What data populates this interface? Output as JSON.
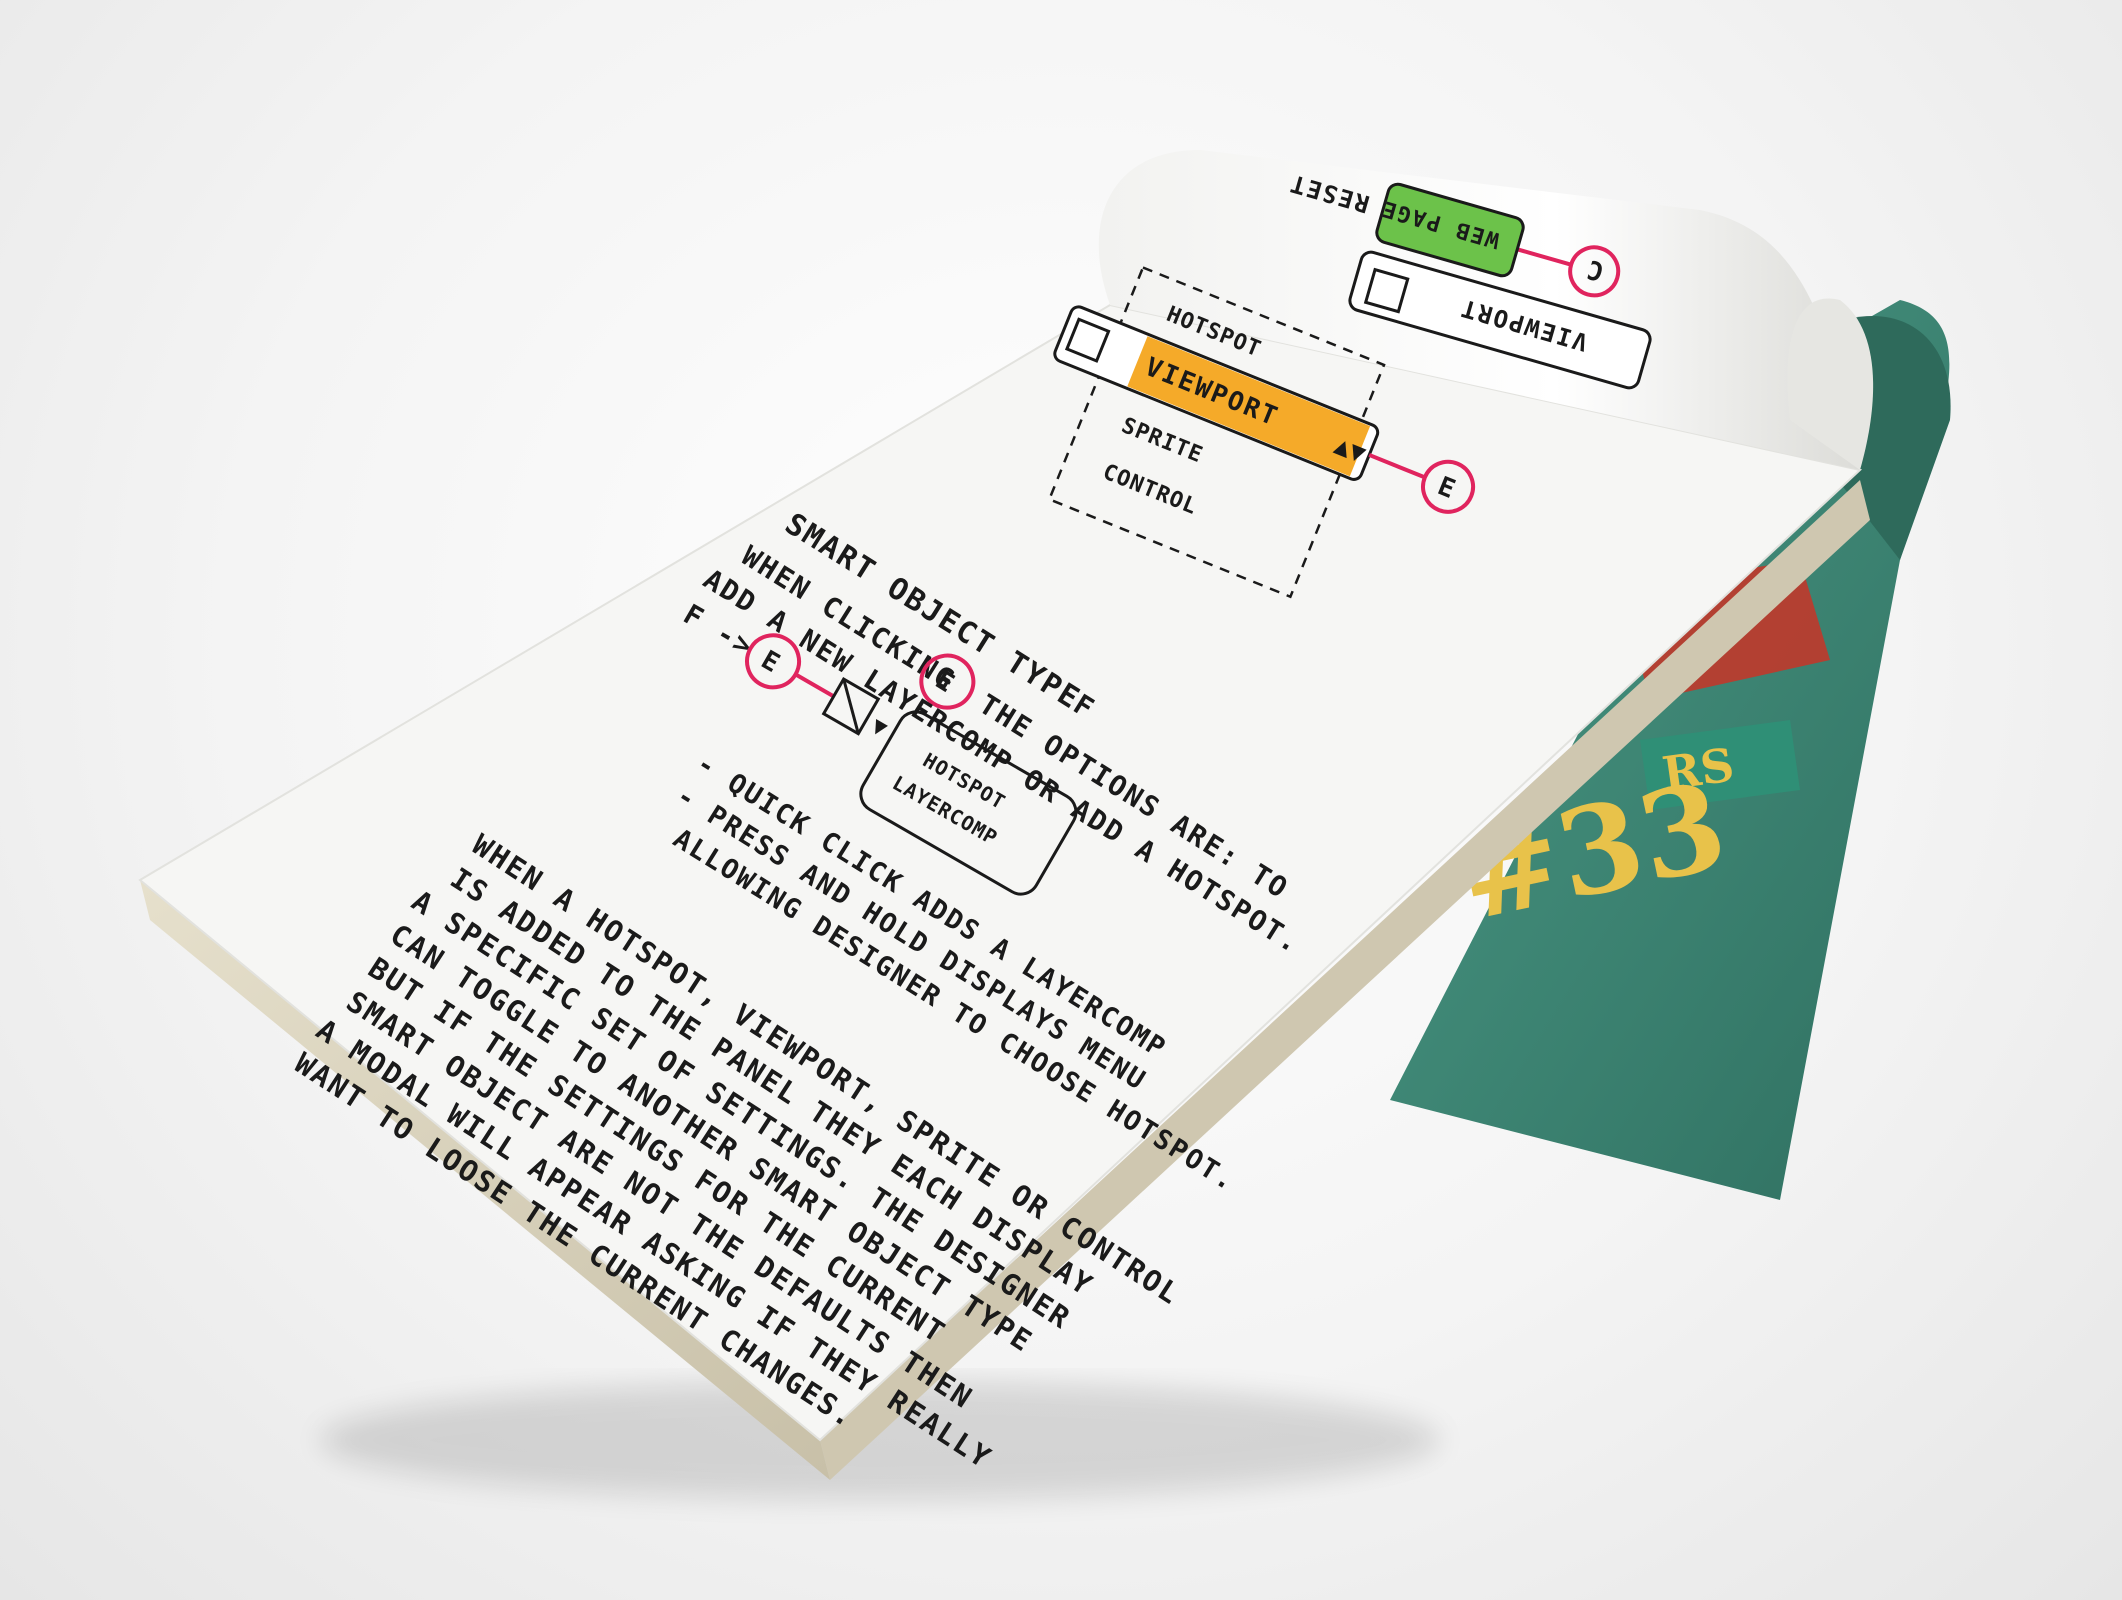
{
  "notepad": {
    "paper_color": "#f6f6f4",
    "edge_color": "#d8d2c0",
    "heading": "SMART OBJECT TYPE",
    "intro_lines": [
      "WHEN CLICKING",
      "THE OPTIONS ARE: TO",
      "ADD A NEW LAYERCOMP OR ADD A HOTSPOT."
    ],
    "marker_e": "E",
    "marker_f": "F",
    "marker_c": "C",
    "f_arrow_label": "F ->",
    "dropdown_options": [
      "HOTSPOT",
      "VIEWPORT",
      "SPRITE",
      "CONTROL"
    ],
    "dropdown_selected": "VIEWPORT",
    "dropdown_highlight_color": "#f4a51e",
    "popup_menu": [
      "HOTSPOT",
      "LAYERCOMP"
    ],
    "bullets": [
      "- QUICK CLICK ADDS A LAYERCOMP",
      "- PRESS AND HOLD DISPLAYS MENU",
      "ALLOWING DESIGNER TO CHOOSE HOTSPOT."
    ],
    "paragraph": [
      "WHEN A HOTSPOT, VIEWPORT, SPRITE OR CONTROL",
      "IS ADDED TO THE PANEL THEY EACH DISPLAY",
      "A SPECIFIC SET OF SETTINGS. THE DESIGNER",
      "CAN TOGGLE TO ANOTHER SMART OBJECT TYPE",
      "BUT IF THE SETTINGS FOR THE CURRENT",
      "SMART OBJECT ARE NOT THE DEFAULTS THEN",
      "A MODAL WILL APPEAR ASKING IF THEY REALLY",
      "WANT TO LOOSE THE CURRENT CHANGES."
    ],
    "curled_page": {
      "reset_label": "RESET",
      "webpage_label": "WEB PAGE",
      "webpage_color": "#6cc24a",
      "viewport_label": "VIEWPORT"
    },
    "back_cover": {
      "color": "#3f8a78",
      "number": "#33",
      "number_color": "#e8c24a",
      "ribbon_text": "RS",
      "badge_color": "#c0392b"
    },
    "marker_color": "#e0245e"
  }
}
